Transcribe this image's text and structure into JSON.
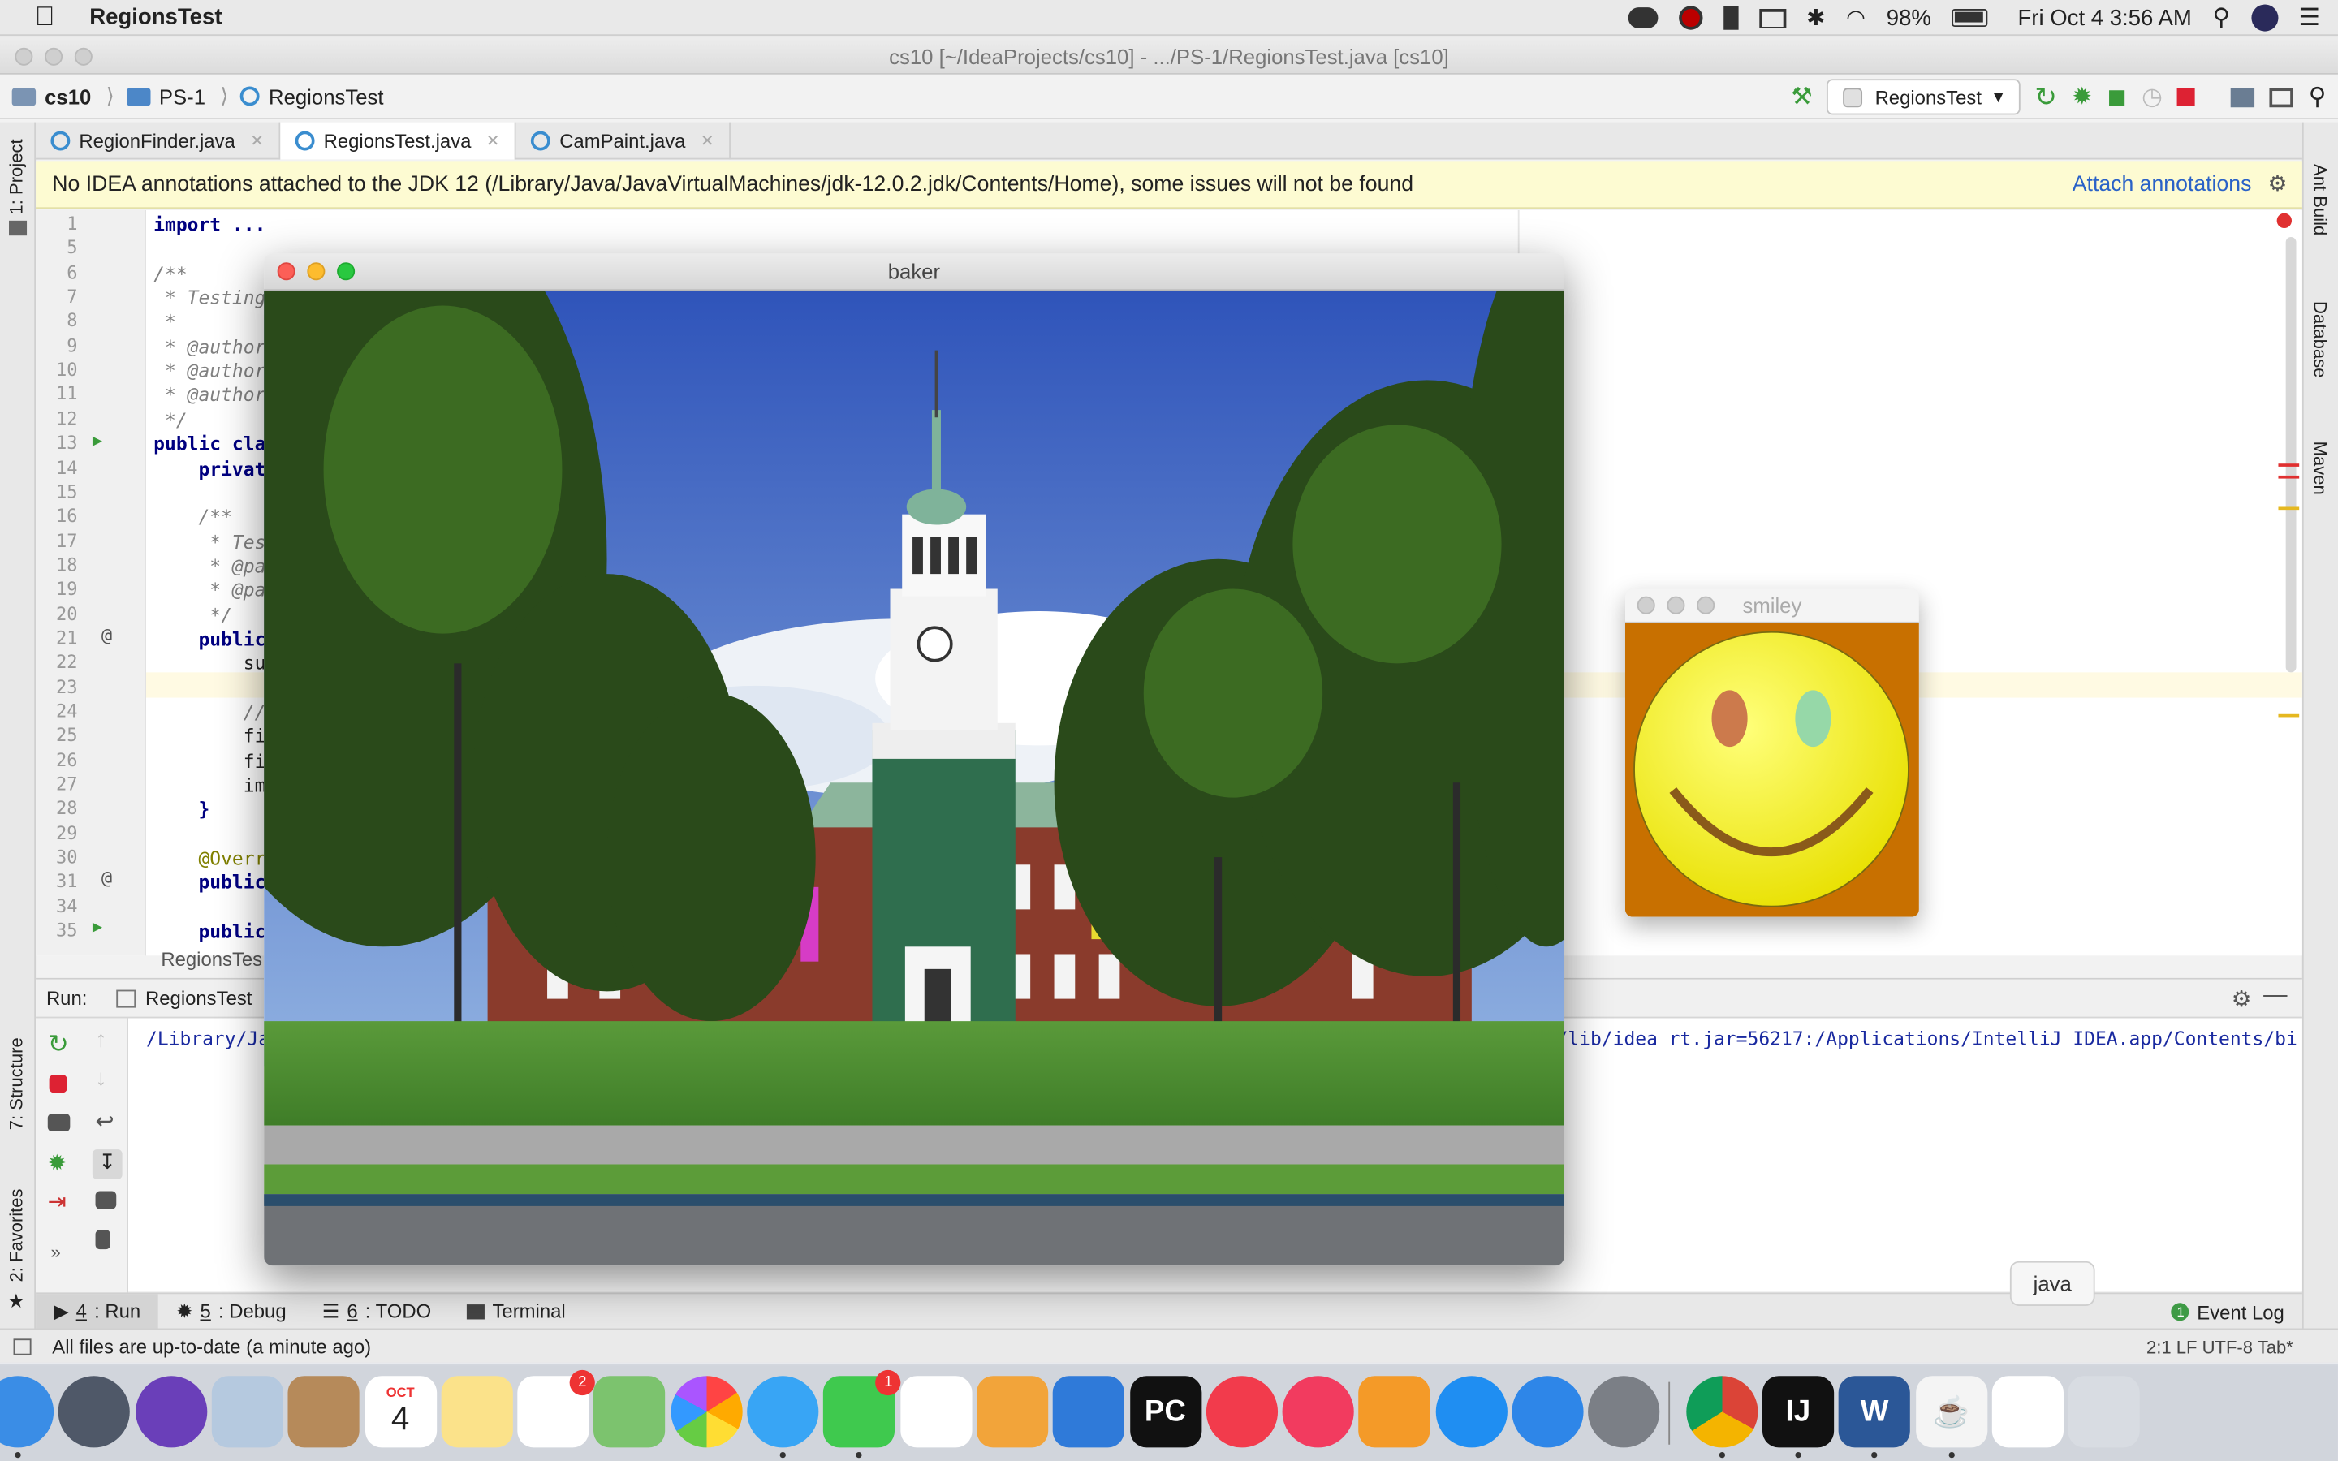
{
  "menubar": {
    "app_name": "RegionsTest",
    "battery": "98%",
    "datetime": "Fri Oct 4  3:56 AM"
  },
  "ide": {
    "window_title": "cs10 [~/IdeaProjects/cs10] - .../PS-1/RegionsTest.java [cs10]",
    "breadcrumbs": [
      "cs10",
      "PS-1",
      "RegionsTest"
    ],
    "run_config": "RegionsTest",
    "tabs": [
      {
        "label": "RegionFinder.java",
        "active": false
      },
      {
        "label": "RegionsTest.java",
        "active": true
      },
      {
        "label": "CamPaint.java",
        "active": false
      }
    ],
    "banner": {
      "text": "No IDEA annotations attached to the JDK 12 (/Library/Java/JavaVirtualMachines/jdk-12.0.2.jdk/Contents/Home), some issues will not be found",
      "link": "Attach annotations"
    },
    "left_tools": [
      "1: Project",
      "7: Structure",
      "2: Favorites"
    ],
    "right_tools": [
      "Ant Build",
      "Database",
      "Maven"
    ],
    "code_lines": [
      {
        "n": "1",
        "text": "import ..."
      },
      {
        "n": "5",
        "text": ""
      },
      {
        "n": "6",
        "text": "/**"
      },
      {
        "n": "7",
        "text": " * Testing"
      },
      {
        "n": "8",
        "text": " *"
      },
      {
        "n": "9",
        "text": " * @author"
      },
      {
        "n": "10",
        "text": " * @author"
      },
      {
        "n": "11",
        "text": " * @author"
      },
      {
        "n": "12",
        "text": " */"
      },
      {
        "n": "13",
        "text": "public cla"
      },
      {
        "n": "14",
        "text": "    privat"
      },
      {
        "n": "15",
        "text": ""
      },
      {
        "n": "16",
        "text": "    /**"
      },
      {
        "n": "17",
        "text": "     * Tes"
      },
      {
        "n": "18",
        "text": "     * @pa"
      },
      {
        "n": "19",
        "text": "     * @pa"
      },
      {
        "n": "20",
        "text": "     */"
      },
      {
        "n": "21",
        "text": "    public"
      },
      {
        "n": "22",
        "text": "        su"
      },
      {
        "n": "23",
        "text": ""
      },
      {
        "n": "24",
        "text": "        //"
      },
      {
        "n": "25",
        "text": "        fi"
      },
      {
        "n": "26",
        "text": "        fi"
      },
      {
        "n": "27",
        "text": "        im"
      },
      {
        "n": "28",
        "text": "    }"
      },
      {
        "n": "29",
        "text": ""
      },
      {
        "n": "30",
        "text": "    @Overr"
      },
      {
        "n": "31",
        "text": "    public"
      },
      {
        "n": "34",
        "text": ""
      },
      {
        "n": "35",
        "text": "    public"
      }
    ],
    "editor_breadcrumb": "RegionsTes",
    "run_panel": {
      "label": "Run:",
      "tab": "RegionsTest",
      "console_left": "/Library/Ja",
      "console_right": "/lib/idea_rt.jar=56217:/Applications/IntelliJ IDEA.app/Contents/bi"
    },
    "tool_windows": [
      {
        "num": "4",
        "rest": ": Run",
        "active": true
      },
      {
        "num": "5",
        "rest": ": Debug",
        "active": false
      },
      {
        "num": "6",
        "rest": ": TODO",
        "active": false
      },
      {
        "num": "",
        "rest": "Terminal",
        "active": false
      }
    ],
    "event_log": "Event Log",
    "event_count": "1",
    "status": "All files are up-to-date (a minute ago)",
    "status_right": "2:1   LF   UTF-8   Tab*"
  },
  "baker": {
    "title": "baker"
  },
  "smiley": {
    "title": "smiley"
  },
  "tooltip": "java",
  "dock": {
    "items": [
      {
        "name": "finder-icon",
        "color": "#3a8de6"
      },
      {
        "name": "launchpad-icon",
        "color": "#4f5868"
      },
      {
        "name": "siri-icon",
        "color": "#6a3fb9"
      },
      {
        "name": "mail-icon",
        "color": "#b5c9df"
      },
      {
        "name": "contacts-icon",
        "color": "#b68a5a"
      },
      {
        "name": "calendar-icon",
        "color": "#ffffff"
      },
      {
        "name": "notes-icon",
        "color": "#fbe28a"
      },
      {
        "name": "reminders-icon",
        "color": "#ffffff"
      },
      {
        "name": "maps-icon",
        "color": "#7cc36e"
      },
      {
        "name": "photos-icon",
        "color": "#ffffff"
      },
      {
        "name": "messages-icon",
        "color": "#38a5f5"
      },
      {
        "name": "facetime-icon",
        "color": "#3fc94e"
      },
      {
        "name": "numbers-icon",
        "color": "#ffffff"
      },
      {
        "name": "pages-icon",
        "color": "#f2a43a"
      },
      {
        "name": "keynote-icon",
        "color": "#2f7ad9"
      },
      {
        "name": "pycharm-icon",
        "color": "#111111"
      },
      {
        "name": "news-icon",
        "color": "#f23b4c"
      },
      {
        "name": "music-icon",
        "color": "#f23b5f"
      },
      {
        "name": "books-icon",
        "color": "#f49a28"
      },
      {
        "name": "appstore-icon",
        "color": "#1f8ef2"
      },
      {
        "name": "safari-icon",
        "color": "#2e86e8"
      },
      {
        "name": "system-preferences-icon",
        "color": "#7b7f86"
      },
      {
        "name": "chrome-icon",
        "color": "#ffffff"
      },
      {
        "name": "intellij-icon",
        "color": "#111111"
      },
      {
        "name": "word-icon",
        "color": "#2b5797"
      },
      {
        "name": "java-icon",
        "color": "#f4f4f4"
      },
      {
        "name": "preview-icon",
        "color": "#ffffff"
      },
      {
        "name": "trash-icon",
        "color": "#d8dce2"
      }
    ],
    "calendar_month": "OCT",
    "calendar_day": "4",
    "reminders_badge": "2",
    "facetime_badge": "1",
    "pycharm_label": "PC",
    "intellij_label": "IJ",
    "word_label": "W"
  }
}
